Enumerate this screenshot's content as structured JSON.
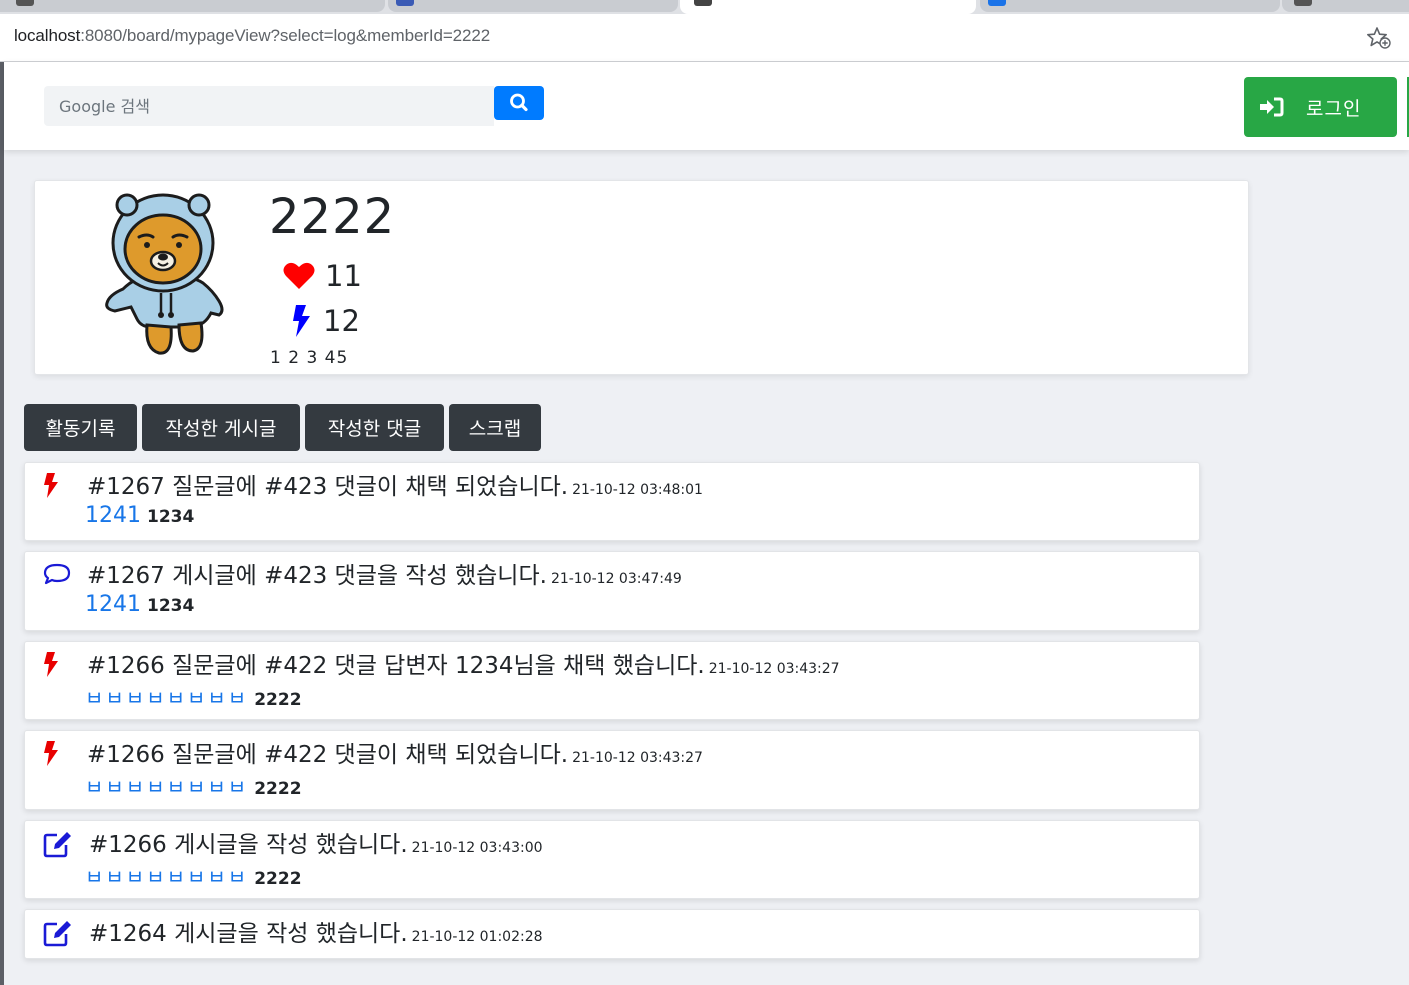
{
  "browser": {
    "url_host": "localhost",
    "url_rest": ":8080/board/mypageView?select=log&memberId=2222"
  },
  "navbar": {
    "search_placeholder": "Google 검색",
    "login_label": "로그인"
  },
  "profile": {
    "member_id": "2222",
    "likes": "11",
    "bolts": "12",
    "page_numbers": "1 2 3 45"
  },
  "tabs": [
    {
      "label": "활동기록"
    },
    {
      "label": "작성한 게시글"
    },
    {
      "label": "작성한 댓글"
    },
    {
      "label": "스크랩"
    }
  ],
  "logs": [
    {
      "icon": "bolt-icon",
      "message": "#1267  질문글에 #423 댓글이 채택 되었습니다.",
      "time": "21-10-12 03:48:01",
      "post_title": "1241",
      "author": "1234"
    },
    {
      "icon": "comment-icon",
      "message": "#1267  게시글에 #423 댓글을 작성 했습니다.",
      "time": "21-10-12 03:47:49",
      "post_title": "1241",
      "author": "1234"
    },
    {
      "icon": "bolt-icon",
      "message": "#1266  질문글에 #422 댓글 답변자 1234님을 채택 했습니다.",
      "time": "21-10-12 03:43:27",
      "post_title": "ㅂㅂㅂㅂㅂㅂㅂㅂ",
      "author": "2222"
    },
    {
      "icon": "bolt-icon",
      "message": "#1266  질문글에 #422 댓글이 채택 되었습니다.",
      "time": "21-10-12 03:43:27",
      "post_title": "ㅂㅂㅂㅂㅂㅂㅂㅂ",
      "author": "2222"
    },
    {
      "icon": "edit-icon",
      "message": "#1266 게시글을 작성 했습니다.",
      "time": "21-10-12 03:43:00",
      "post_title": "ㅂㅂㅂㅂㅂㅂㅂㅂ",
      "author": "2222"
    },
    {
      "icon": "edit-icon",
      "message": "#1264 게시글을 작성 했습니다.",
      "time": "21-10-12 01:02:28"
    }
  ],
  "colors": {
    "accent_blue": "#007bff",
    "login_green": "#28a745",
    "heart_red": "#ff0000",
    "bolt_blue": "#0000ff",
    "bolt_red": "#e80000",
    "link_blue": "#1876e8",
    "tab_dark": "#343a40"
  }
}
